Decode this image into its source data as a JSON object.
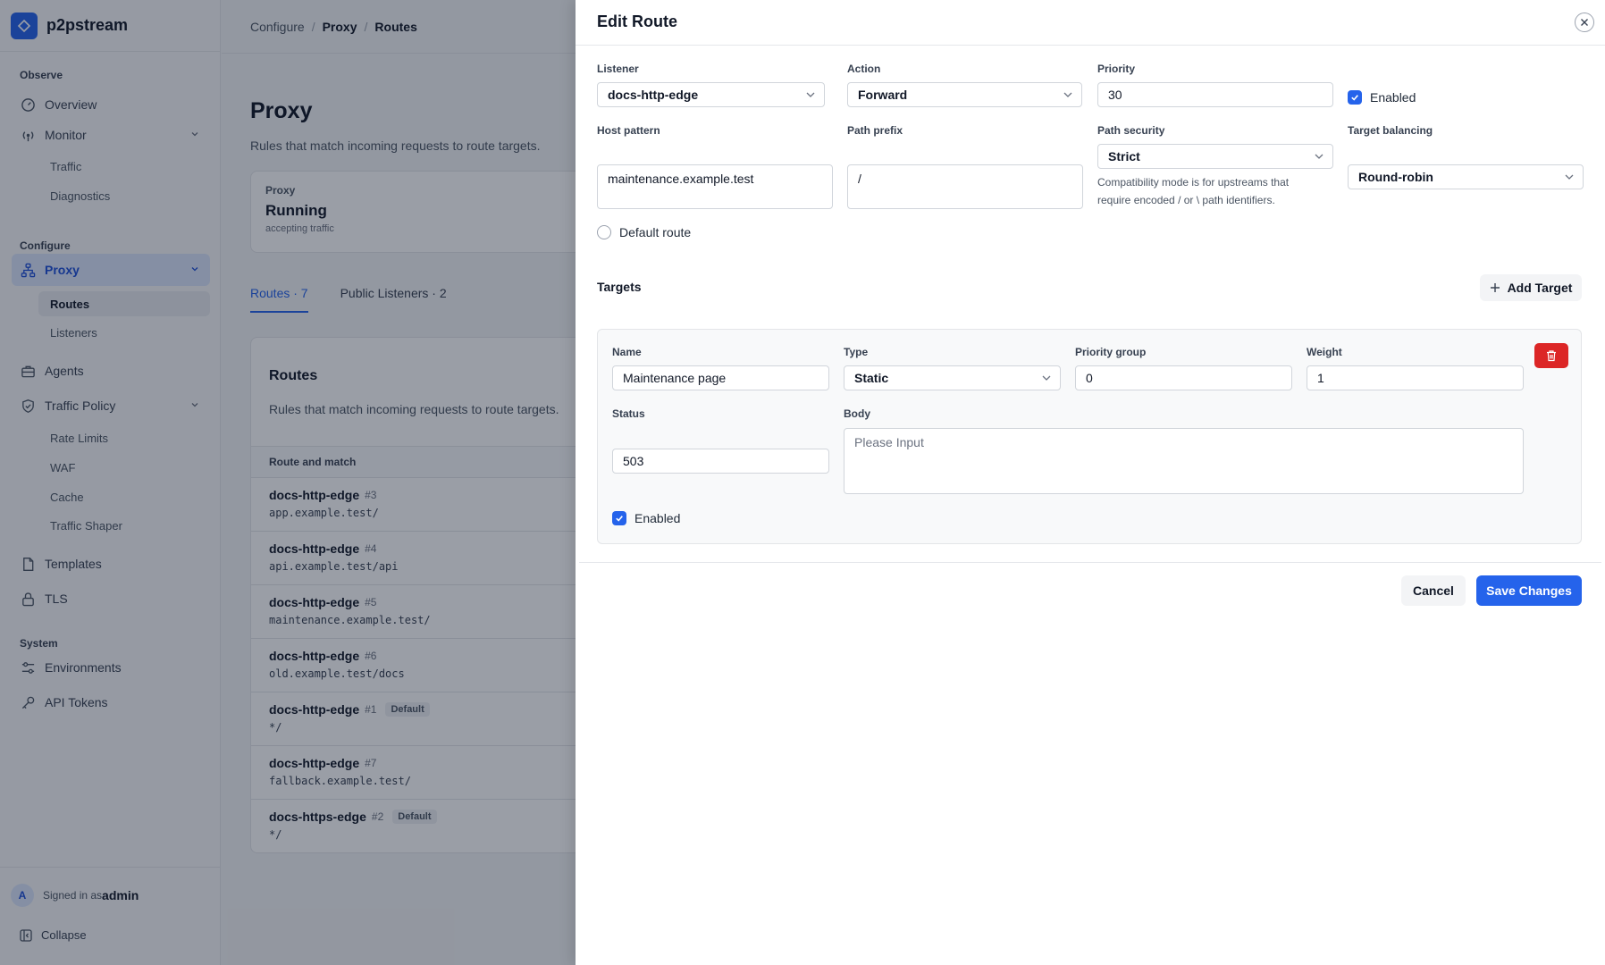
{
  "app": {
    "name": "p2pstream"
  },
  "sidebar": {
    "sections": {
      "observe": "Observe",
      "configure": "Configure",
      "system": "System"
    },
    "items": {
      "overview": "Overview",
      "monitor": "Monitor",
      "traffic": "Traffic",
      "diagnostics": "Diagnostics",
      "proxy": "Proxy",
      "routes": "Routes",
      "listeners": "Listeners",
      "agents": "Agents",
      "traffic_policy": "Traffic Policy",
      "rate_limits": "Rate Limits",
      "waf": "WAF",
      "cache": "Cache",
      "traffic_shaper": "Traffic Shaper",
      "templates": "Templates",
      "tls": "TLS",
      "environments": "Environments",
      "api_tokens": "API Tokens"
    },
    "footer": {
      "avatar_initial": "A",
      "signed_in_as": "Signed in as",
      "user": "admin",
      "collapse": "Collapse"
    }
  },
  "breadcrumb": [
    "Configure",
    "Proxy",
    "Routes"
  ],
  "page": {
    "title": "Proxy",
    "subtitle": "Rules that match incoming requests to route targets.",
    "status_card": {
      "label": "Proxy",
      "value": "Running",
      "note": "accepting traffic"
    },
    "tabs": [
      "Routes · 7",
      "Public Listeners · 2"
    ],
    "routes_card": {
      "title": "Routes",
      "subtitle": "Rules that match incoming requests to route targets.",
      "column": "Route and match",
      "rows": [
        {
          "name": "docs-http-edge",
          "id": "#3",
          "match": "app.example.test/",
          "badge": ""
        },
        {
          "name": "docs-http-edge",
          "id": "#4",
          "match": "api.example.test/api",
          "badge": ""
        },
        {
          "name": "docs-http-edge",
          "id": "#5",
          "match": "maintenance.example.test/",
          "badge": ""
        },
        {
          "name": "docs-http-edge",
          "id": "#6",
          "match": "old.example.test/docs",
          "badge": ""
        },
        {
          "name": "docs-http-edge",
          "id": "#1",
          "match": "*/",
          "badge": "Default"
        },
        {
          "name": "docs-http-edge",
          "id": "#7",
          "match": "fallback.example.test/",
          "badge": ""
        },
        {
          "name": "docs-https-edge",
          "id": "#2",
          "match": "*/",
          "badge": "Default"
        }
      ]
    }
  },
  "drawer": {
    "title": "Edit Route",
    "fields": {
      "listener": {
        "label": "Listener",
        "value": "docs-http-edge"
      },
      "action": {
        "label": "Action",
        "value": "Forward"
      },
      "priority": {
        "label": "Priority",
        "value": "30"
      },
      "enabled": {
        "label": "Enabled",
        "checked": true
      },
      "host_pattern": {
        "label": "Host pattern",
        "value": "maintenance.example.test"
      },
      "path_prefix": {
        "label": "Path prefix",
        "value": "/"
      },
      "path_security": {
        "label": "Path security",
        "value": "Strict",
        "help": "Compatibility mode is for upstreams that require encoded / or \\ path identifiers."
      },
      "target_balancing": {
        "label": "Target balancing",
        "value": "Round-robin"
      },
      "default_route": {
        "label": "Default route",
        "checked": false
      }
    },
    "targets": {
      "title": "Targets",
      "add_label": "Add Target",
      "items": [
        {
          "name_label": "Name",
          "name": "Maintenance page",
          "type_label": "Type",
          "type": "Static",
          "priority_group_label": "Priority group",
          "priority_group": "0",
          "weight_label": "Weight",
          "weight": "1",
          "status_label": "Status",
          "status": "503",
          "body_label": "Body",
          "body_placeholder": "Please Input",
          "enabled_label": "Enabled",
          "enabled": true
        }
      ]
    },
    "buttons": {
      "cancel": "Cancel",
      "save": "Save Changes"
    }
  },
  "colors": {
    "accent": "#2563eb",
    "danger": "#dc2626",
    "overlay": "rgba(15,23,42,0.42)"
  }
}
